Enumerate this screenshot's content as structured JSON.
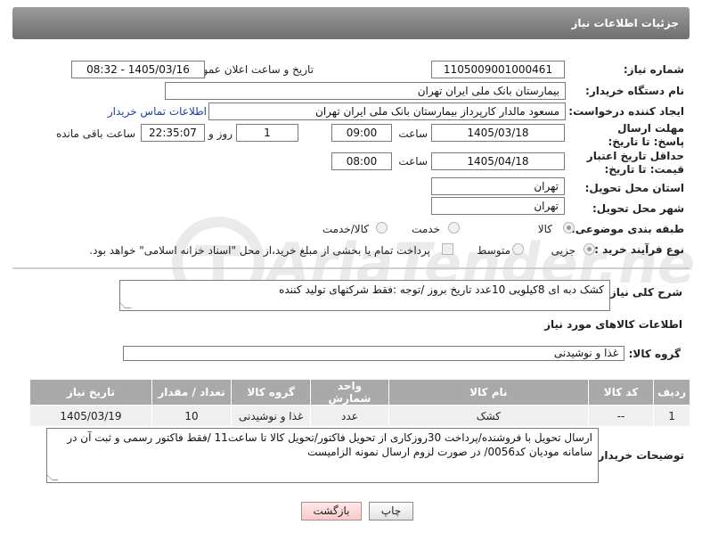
{
  "header": {
    "title": "جزئیات اطلاعات نیاز"
  },
  "form": {
    "need_number": {
      "label": "شماره نیاز:",
      "value": "1105009001000461"
    },
    "announce_date": {
      "label": "تاریخ و ساعت اعلان عمومی:",
      "value": "1405/03/16 - 08:32"
    },
    "buyer_org": {
      "label": "نام دستگاه خریدار:",
      "value": "بیمارستان بانک ملی ایران تهران"
    },
    "requester": {
      "label": "ایجاد کننده درخواست:",
      "value": "مسعود مالدار کارپرداز بیمارستان بانک ملی ایران تهران",
      "contact_link": "اطلاعات تماس خریدار"
    },
    "response_deadline": {
      "label": "مهلت ارسال پاسخ: تا تاریخ:",
      "date": "1405/03/18",
      "time_label": "ساعت",
      "time": "09:00",
      "days": "1",
      "days_label": "روز و",
      "remaining": "22:35:07",
      "remaining_label": "ساعت باقی مانده"
    },
    "price_validity": {
      "label": "حداقل تاریخ اعتبار قیمت: تا تاریخ:",
      "date": "1405/04/18",
      "time_label": "ساعت",
      "time": "08:00"
    },
    "delivery_province": {
      "label": "استان محل تحویل:",
      "value": "تهران"
    },
    "delivery_city": {
      "label": "شهر محل تحویل:",
      "value": "تهران"
    },
    "category": {
      "label": "طبقه بندی موضوعی:",
      "options": [
        "کالا",
        "خدمت",
        "کالا/خدمت"
      ],
      "selected": "کالا"
    },
    "purchase_type": {
      "label": "نوع فرآیند خرید :",
      "options": [
        "جزیی",
        "متوسط"
      ],
      "selected": "جزیی",
      "payment_note": "پرداخت تمام یا بخشی از مبلغ خرید،از محل \"اسناد خزانه اسلامی\" خواهد بود."
    }
  },
  "description": {
    "label": "شرح کلی نیاز:",
    "value": "کشک دبه ای 8کیلویی 10عدد تاریخ بروز /توجه :فقط شرکتهای تولید کننده"
  },
  "goods_section": {
    "title": "اطلاعات کالاهای مورد نیاز",
    "group_label": "گروه کالا:",
    "group_value": "غذا و نوشیدنی"
  },
  "table": {
    "headers": [
      "ردیف",
      "کد کالا",
      "نام کالا",
      "واحد شمارش",
      "گروه کالا",
      "تعداد / مقدار",
      "تاریخ نیاز"
    ],
    "rows": [
      [
        "1",
        "--",
        "کشک",
        "عدد",
        "غذا و نوشیدنی",
        "10",
        "1405/03/19"
      ]
    ]
  },
  "buyer_notes": {
    "label": "توضیحات خریدار:",
    "value": "ارسال تحویل با فروشنده/پرداخت 30روزکاری از تحویل فاکتور/تحویل کالا تا ساعت11 /فقط فاکتور رسمی و ثبت آن در سامانه مودیان کد0056/ در صورت لزوم ارسال نمونه الزامیست"
  },
  "buttons": {
    "print": "چاپ",
    "back": "بازگشت"
  },
  "watermark": {
    "text": "AriaTender.net"
  },
  "colors": {
    "header_bg": "#7d7d7d",
    "table_header_bg": "#a9a9a9",
    "link": "#1a3f9e",
    "back_button": "#f6caca"
  }
}
